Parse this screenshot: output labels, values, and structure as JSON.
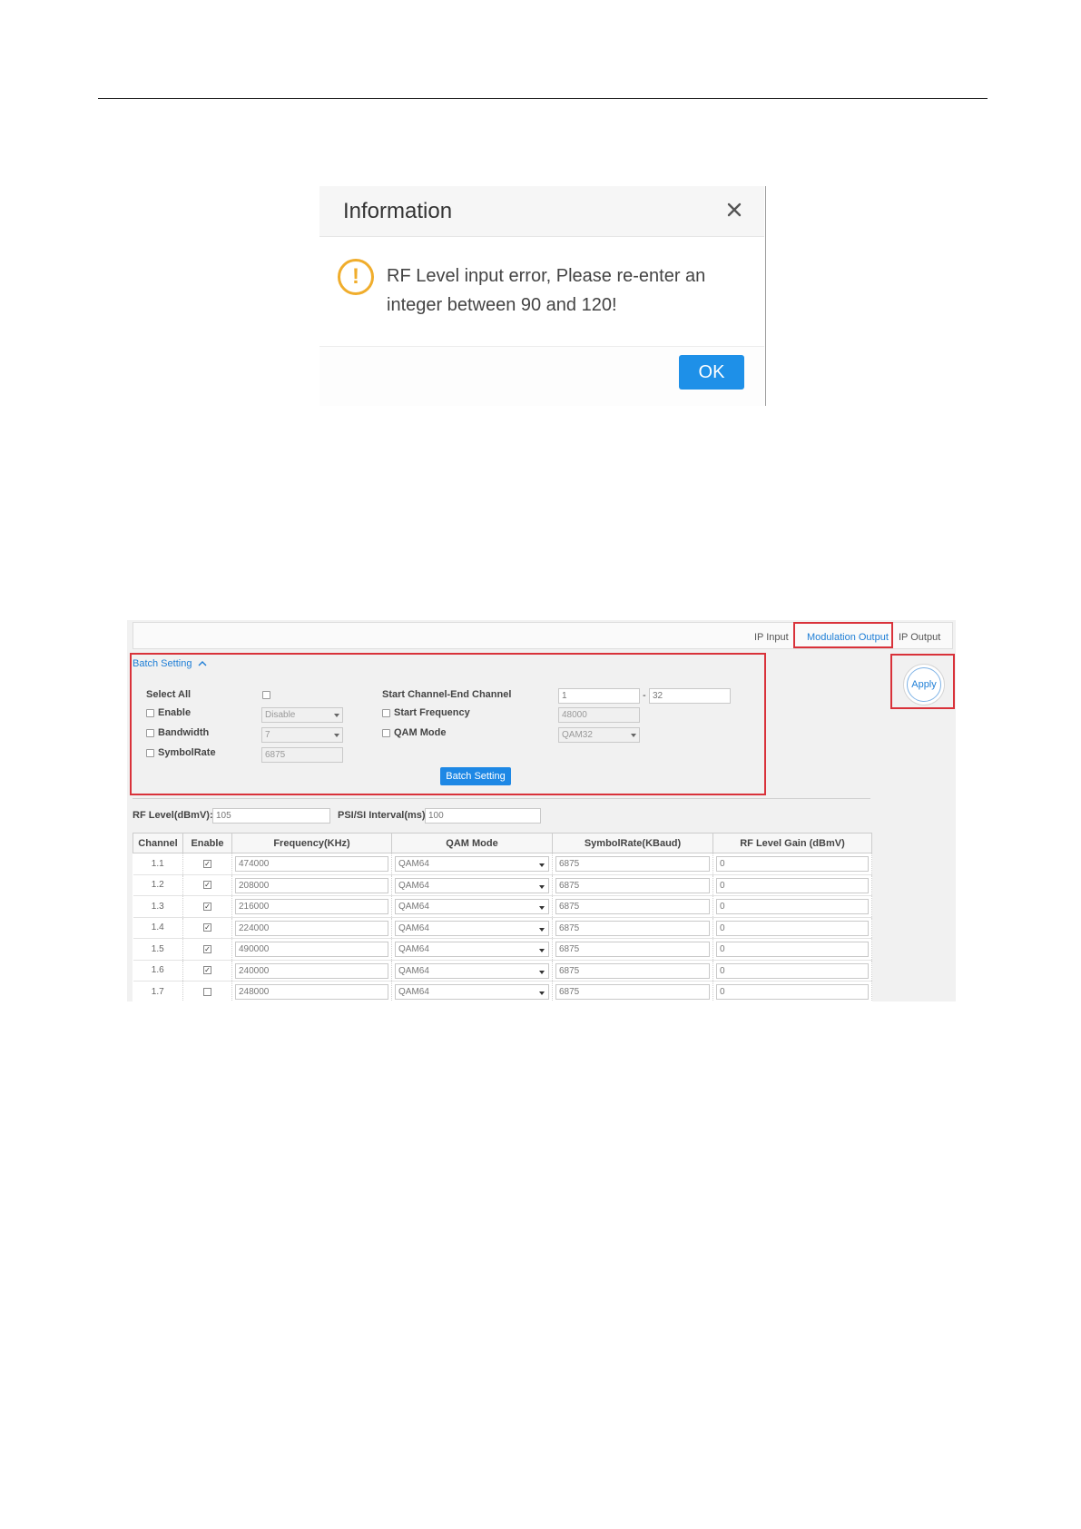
{
  "dialog": {
    "title": "Information",
    "message": "RF Level input error, Please re-enter an integer between 90 and 120!",
    "ok_label": "OK",
    "colors": {
      "ok_button": "#1e90e8",
      "warning": "#f0ad2c"
    }
  },
  "tabs": [
    {
      "label": "IP Input",
      "active": false
    },
    {
      "label": "Modulation Output",
      "active": true
    },
    {
      "label": "IP Output",
      "active": false
    }
  ],
  "apply_label": "Apply",
  "batch": {
    "toggle_label": "Batch Setting",
    "select_all_label": "Select All",
    "enable_label": "Enable",
    "enable_value": "Disable",
    "bandwidth_label": "Bandwidth",
    "bandwidth_value": "7",
    "symbolrate_label": "SymbolRate",
    "symbolrate_value": "6875",
    "channel_range_label": "Start Channel-End Channel",
    "start_channel": "1",
    "range_separator": "-",
    "end_channel": "32",
    "start_freq_label": "Start Frequency",
    "start_freq_value": "48000",
    "qam_mode_label": "QAM Mode",
    "qam_mode_value": "QAM32",
    "button_label": "Batch Setting"
  },
  "params": {
    "rf_level_label": "RF Level(dBmV):",
    "rf_level_value": "105",
    "psi_label": "PSI/SI Interval(ms):",
    "psi_value": "100"
  },
  "table": {
    "headers": [
      "Channel",
      "Enable",
      "Frequency(KHz)",
      "QAM Mode",
      "SymbolRate(KBaud)",
      "RF Level Gain (dBmV)"
    ],
    "rows": [
      {
        "channel": "1.1",
        "enabled": true,
        "frequency": "474000",
        "qam": "QAM64",
        "symbolrate": "6875",
        "gain": "0"
      },
      {
        "channel": "1.2",
        "enabled": true,
        "frequency": "208000",
        "qam": "QAM64",
        "symbolrate": "6875",
        "gain": "0"
      },
      {
        "channel": "1.3",
        "enabled": true,
        "frequency": "216000",
        "qam": "QAM64",
        "symbolrate": "6875",
        "gain": "0"
      },
      {
        "channel": "1.4",
        "enabled": true,
        "frequency": "224000",
        "qam": "QAM64",
        "symbolrate": "6875",
        "gain": "0"
      },
      {
        "channel": "1.5",
        "enabled": true,
        "frequency": "490000",
        "qam": "QAM64",
        "symbolrate": "6875",
        "gain": "0"
      },
      {
        "channel": "1.6",
        "enabled": true,
        "frequency": "240000",
        "qam": "QAM64",
        "symbolrate": "6875",
        "gain": "0"
      },
      {
        "channel": "1.7",
        "enabled": false,
        "frequency": "248000",
        "qam": "QAM64",
        "symbolrate": "6875",
        "gain": "0"
      }
    ]
  }
}
